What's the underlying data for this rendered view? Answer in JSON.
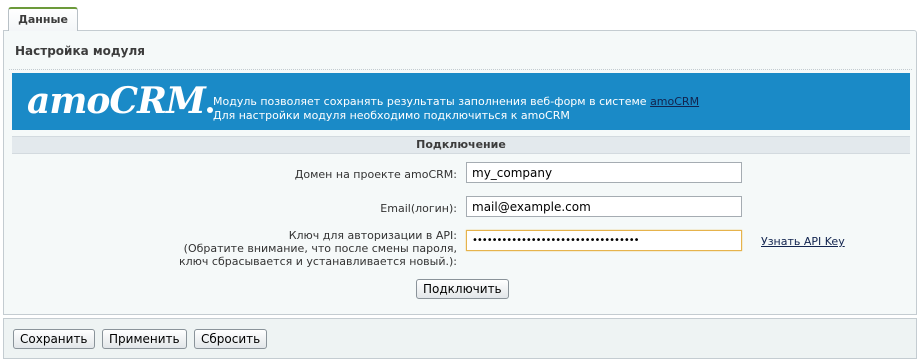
{
  "tab": {
    "label": "Данные"
  },
  "panel": {
    "title": "Настройка модуля"
  },
  "banner": {
    "logo": "amoCRM",
    "line1_prefix": "Модуль позволяет сохранять результаты заполнения веб-форм в системе ",
    "line1_link": "amoCRM",
    "line2": "Для настройки модуля необходимо подключиться к amoCRM",
    "background_color": "#1a8ac7"
  },
  "section": {
    "title": "Подключение"
  },
  "form": {
    "domain": {
      "label": "Домен на проекте amoCRM:",
      "value": "my_company"
    },
    "email": {
      "label": "Email(логин):",
      "value": "mail@example.com"
    },
    "api_key": {
      "label_line1": "Ключ для авторизации в API:",
      "label_line2": "(Обратите внимание, что после смены пароля,",
      "label_line3": "ключ сбрасывается и устанавливается новый.):",
      "value": "••••••••••••••••••••••••••••••••••",
      "link": "Узнать API Key"
    },
    "connect_label": "Подключить"
  },
  "footer": {
    "save_label": "Сохранить",
    "apply_label": "Применить",
    "reset_label": "Сбросить"
  }
}
